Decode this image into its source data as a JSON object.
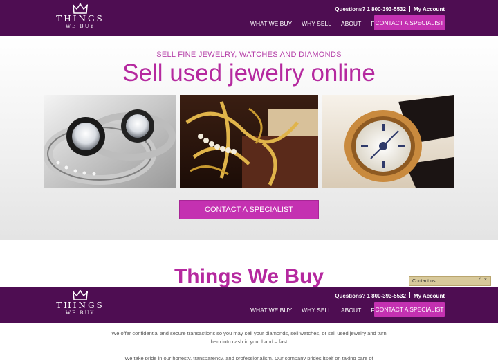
{
  "header": {
    "logo_text": "THINGS",
    "logo_sub": "WE BUY",
    "phone": "Questions? 1 800-393-5532",
    "account": "My Account",
    "nav": [
      "WHAT WE BUY",
      "WHY SELL",
      "ABOUT",
      "FAQ"
    ],
    "cta": "CONTACT A SPECIALIST"
  },
  "hero": {
    "kicker": "SELL FINE JEWELRY, WATCHES AND DIAMONDS",
    "headline": "Sell used jewelry online",
    "cta": "CONTACT A SPECIALIST",
    "images": [
      "diamond-rings-photo",
      "gold-jewelry-box-photo",
      "gold-watch-photo"
    ]
  },
  "section": {
    "title": "Things We Buy",
    "paragraph1": "We offer confidential and secure transactions so you may sell your diamonds, sell watches, or sell used jewelry and turn them into cash in your hand – fast.",
    "paragraph2": "We take pride in our honesty, transparency, and professionalism. Our company prides itself on taking care of"
  },
  "chat": {
    "label": "Contact us!",
    "controls": [
      "^",
      "×"
    ]
  },
  "colors": {
    "header_bg": "#4e0d52",
    "accent": "#c431b1",
    "headline": "#b5299f"
  }
}
